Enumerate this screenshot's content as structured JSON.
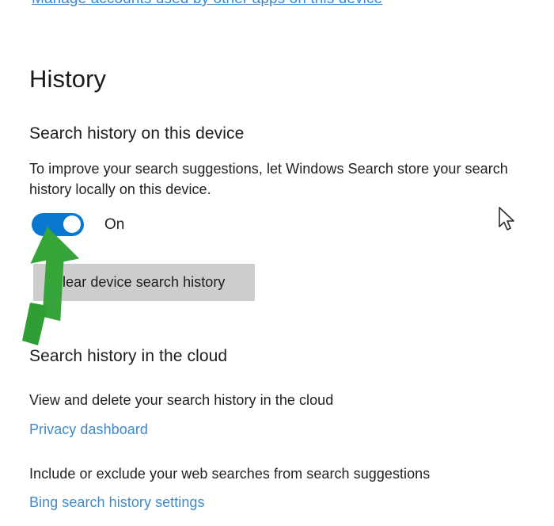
{
  "page": {
    "top_link": "Manage accounts used by other apps on this device",
    "section_title": "History"
  },
  "device_history": {
    "heading": "Search history on this device",
    "description": "To improve your search suggestions, let Windows Search store your search history locally on this device.",
    "toggle": {
      "state_label": "On",
      "checked": true,
      "on_color": "#0b78d0",
      "knob_color": "#ffffff"
    },
    "clear_button": {
      "label": "Clear device search history",
      "background": "#cdcdcd"
    }
  },
  "cloud_history": {
    "heading": "Search history in the cloud",
    "description": "View and delete your search history in the cloud",
    "link": "Privacy dashboard",
    "web_description": "Include or exclude your web searches from search suggestions",
    "web_link": "Bing search history settings"
  },
  "annotation": {
    "arrow_color": "#35a53a",
    "arrow_target": "search-history-toggle"
  },
  "colors": {
    "link": "#4089c8",
    "text": "#1f1f1f",
    "background": "#ffffff"
  }
}
